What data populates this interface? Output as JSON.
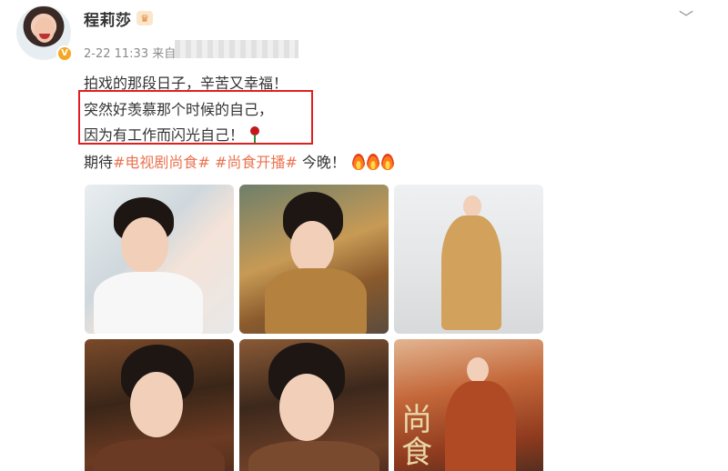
{
  "post": {
    "username": "程莉莎",
    "verified_badge": "V",
    "meta": "2-22 11:33 来自",
    "lines": {
      "line1": "拍戏的那段日子，辛苦又幸福！",
      "line2": "突然好羡慕那个时候的自己，",
      "line3": "因为有工作而闪光自己！",
      "line4_prefix": "期待",
      "hashtag1": "#电视剧尚食#",
      "hashtag2": "#尚食开播#",
      "line4_suffix": "今晚！"
    },
    "poster_glyph": "尚\n食"
  },
  "icons": {
    "crown": "crown-badge-icon",
    "menu": "chevron-down-icon",
    "rose": "rose-icon",
    "fire": "fire-icon"
  },
  "colors": {
    "hashtag": "#eb7350",
    "highlight_box": "#e02020",
    "verified": "#f5a623"
  }
}
